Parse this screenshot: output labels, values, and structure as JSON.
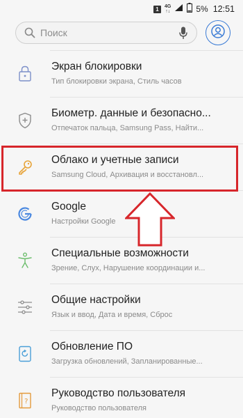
{
  "status_bar": {
    "sim": "1",
    "network": "4G",
    "battery_percent": "5%",
    "time": "12:51"
  },
  "search": {
    "placeholder": "Поиск"
  },
  "settings": {
    "items": [
      {
        "title": "Экран блокировки",
        "subtitle": "Тип блокировки экрана, Стиль часов",
        "icon": "lock-icon"
      },
      {
        "title": "Биометр. данные и безопасно...",
        "subtitle": "Отпечаток пальца, Samsung Pass, Найти...",
        "icon": "shield-plus-icon"
      },
      {
        "title": "Облако и учетные записи",
        "subtitle": "Samsung Cloud, Архивация и восстановл...",
        "icon": "key-icon"
      },
      {
        "title": "Google",
        "subtitle": "Настройки Google",
        "icon": "google-icon"
      },
      {
        "title": "Специальные возможности",
        "subtitle": "Зрение, Слух, Нарушение координации и...",
        "icon": "accessibility-icon"
      },
      {
        "title": "Общие настройки",
        "subtitle": "Язык и ввод, Дата и время, Сброс",
        "icon": "sliders-icon"
      },
      {
        "title": "Обновление ПО",
        "subtitle": "Загрузка обновлений, Запланированные...",
        "icon": "software-update-icon"
      },
      {
        "title": "Руководство пользователя",
        "subtitle": "Руководство пользователя",
        "icon": "user-manual-icon"
      }
    ]
  },
  "colors": {
    "highlight": "#d7262b",
    "accent": "#3a7bd5"
  }
}
